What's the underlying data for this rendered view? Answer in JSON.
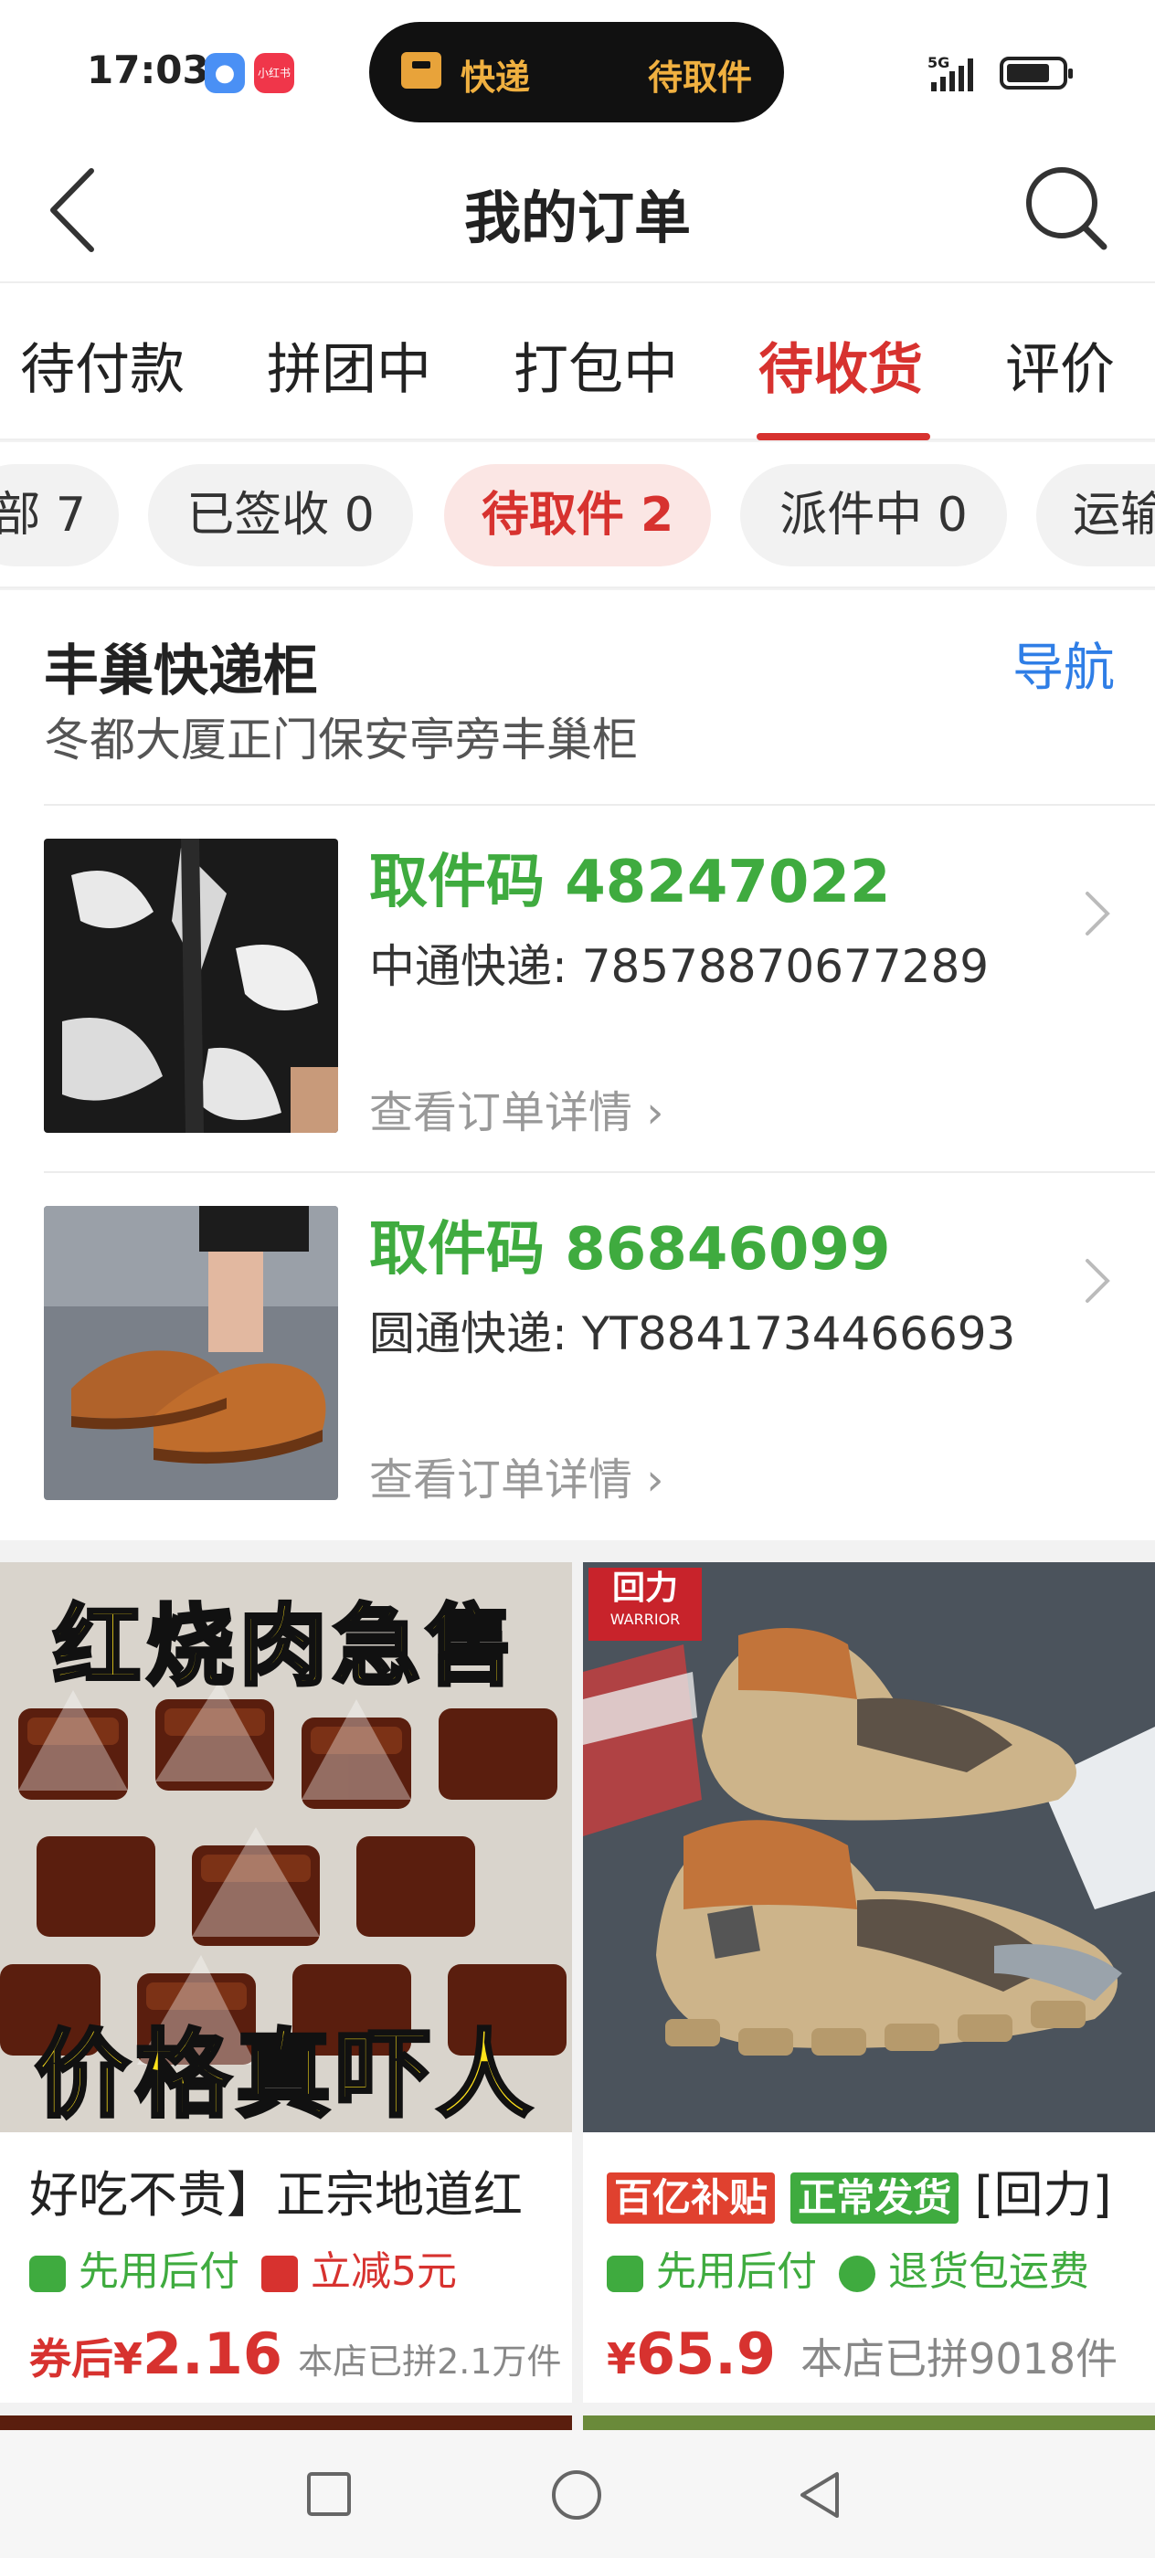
{
  "status_bar": {
    "time": "17:03",
    "app_icons": [
      "message-app-icon",
      "xiaohongshu-app-icon"
    ],
    "xiaohongshu_label": "小红书",
    "island_left": "快递",
    "island_right": "待取件",
    "network": "5G"
  },
  "header": {
    "title": "我的订单",
    "back_icon": "back-chevron-icon",
    "search_icon": "search-icon"
  },
  "tabs": {
    "items": [
      "待付款",
      "拼团中",
      "打包中",
      "待收货",
      "评价"
    ],
    "active": "待收货"
  },
  "filters": {
    "items": [
      "部 7",
      "已签收 0",
      "待取件 2",
      "派件中 0",
      "运输"
    ],
    "active": "待取件 2"
  },
  "pickup": {
    "location_name": "丰巢快递柜",
    "nav_label": "导航",
    "address": "冬都大厦正门保安亭旁丰巢柜",
    "items": [
      {
        "code_text": "取件码 48247022",
        "tracking": "中通快递: 78578870677289",
        "detail_label": "查看订单详情",
        "image": "black-white-patterned-shirt"
      },
      {
        "code_text": "取件码 86846099",
        "tracking": "圆通快递: YT8841734466693",
        "detail_label": "查看订单详情",
        "image": "brown-leather-loafers"
      }
    ]
  },
  "recommendations": [
    {
      "banner_top": "红烧肉急售",
      "banner_bottom": "价格真吓人",
      "title": "好吃不贵】正宗地道红",
      "tag1": "先用后付",
      "tag2": "立减5元",
      "price_prefix": "券后",
      "currency": "¥",
      "price": "2.16",
      "sold": "本店已拼2.1万件"
    },
    {
      "brand_logo": "回力",
      "brand_sub": "WARRIOR",
      "badge1": "百亿补贴",
      "badge2": "正常发货",
      "title": "[回力]",
      "tag1": "先用后付",
      "tag2": "退货包运费",
      "currency": "¥",
      "price": "65.9",
      "sold": "本店已拼9018件"
    }
  ],
  "colors": {
    "accent": "#d7322f",
    "code_green": "#3fab3f",
    "nav_blue": "#2f7ee6"
  }
}
